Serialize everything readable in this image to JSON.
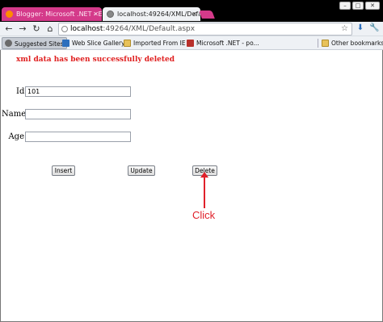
{
  "browser": {
    "tabs": [
      {
        "title": "Blogger: Microsoft .NET - E",
        "active": false
      },
      {
        "title": "localhost:49264/XML/Defau",
        "active": true
      }
    ],
    "address": {
      "host": "localhost",
      "path": ":49264/XML/Default.aspx"
    },
    "bookmarks": [
      {
        "label": "Suggested Sites"
      },
      {
        "label": "Web Slice Gallery"
      },
      {
        "label": "Imported From IE"
      },
      {
        "label": "Microsoft .NET - po..."
      },
      {
        "label": "Other bookmarks"
      }
    ]
  },
  "page": {
    "message": "xml data has been successfully deleted",
    "fields": [
      {
        "label": "Id",
        "value": "101"
      },
      {
        "label": "Name",
        "value": ""
      },
      {
        "label": "Age",
        "value": ""
      }
    ],
    "buttons": {
      "insert": "Insert",
      "update": "Update",
      "delete": "Delete"
    },
    "annotation": "Click"
  },
  "colors": {
    "message": "#e02020",
    "annotation": "#e0202a",
    "tab_inactive": "#d43a8a"
  },
  "icons": [
    "back-icon",
    "forward-icon",
    "reload-icon",
    "home-icon",
    "page-icon",
    "star-icon",
    "extension-icon",
    "wrench-icon",
    "folder-icon"
  ]
}
